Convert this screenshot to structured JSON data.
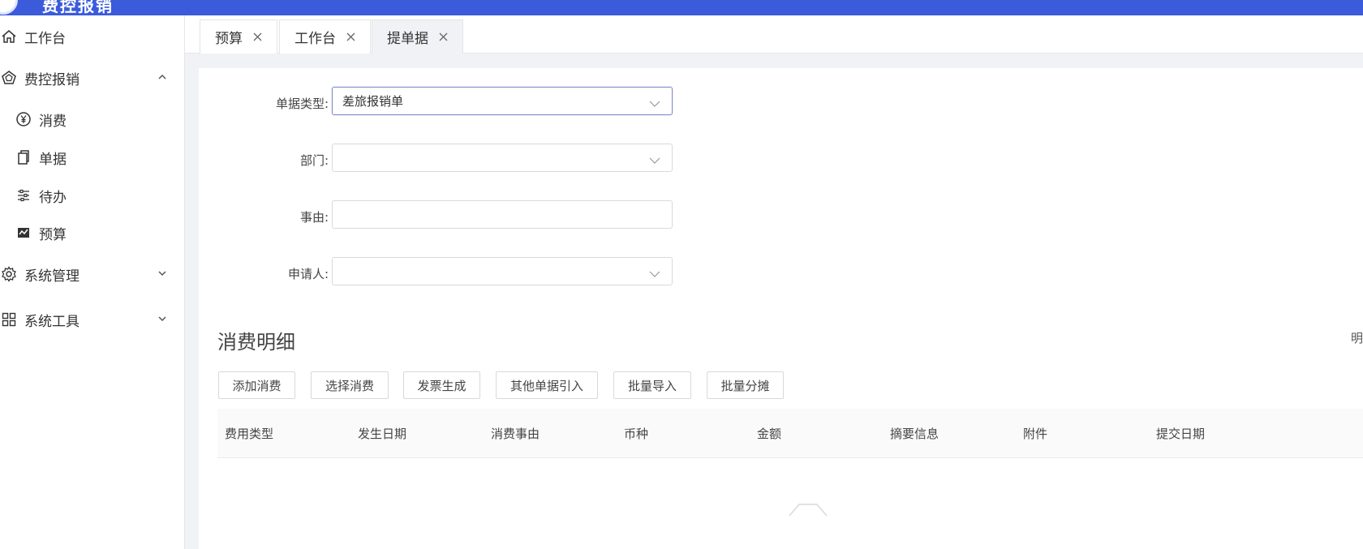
{
  "header": {
    "brand": "费控报销"
  },
  "sidebar": {
    "items": [
      {
        "label": "工作台",
        "icon": "home-icon"
      },
      {
        "label": "费控报销",
        "icon": "pentagon-icon",
        "expanded": true
      },
      {
        "label": "消费",
        "icon": "yen-circle-icon"
      },
      {
        "label": "单据",
        "icon": "documents-icon"
      },
      {
        "label": "待办",
        "icon": "sliders-icon"
      },
      {
        "label": "预算",
        "icon": "chart-icon"
      },
      {
        "label": "系统管理",
        "icon": "gear-icon",
        "expanded": false
      },
      {
        "label": "系统工具",
        "icon": "grid-icon",
        "expanded": false
      }
    ]
  },
  "tabs": [
    {
      "label": "预算",
      "active": false
    },
    {
      "label": "工作台",
      "active": false
    },
    {
      "label": "提单据",
      "active": true
    }
  ],
  "form": {
    "doc_type_label": "单据类型:",
    "doc_type_value": "差旅报销单",
    "dept_label": "部门:",
    "dept_value": "",
    "reason_label": "事由:",
    "reason_value": "",
    "applicant_label": "申请人:",
    "applicant_value": ""
  },
  "detail": {
    "title": "消费明细",
    "right_mark": "明",
    "buttons": [
      "添加消费",
      "选择消费",
      "发票生成",
      "其他单据引入",
      "批量导入",
      "批量分摊"
    ],
    "columns": [
      "费用类型",
      "发生日期",
      "消费事由",
      "币种",
      "金额",
      "摘要信息",
      "附件",
      "提交日期"
    ]
  },
  "colors": {
    "topbar": "#3b5bdb",
    "accent": "#7f8dc7"
  }
}
